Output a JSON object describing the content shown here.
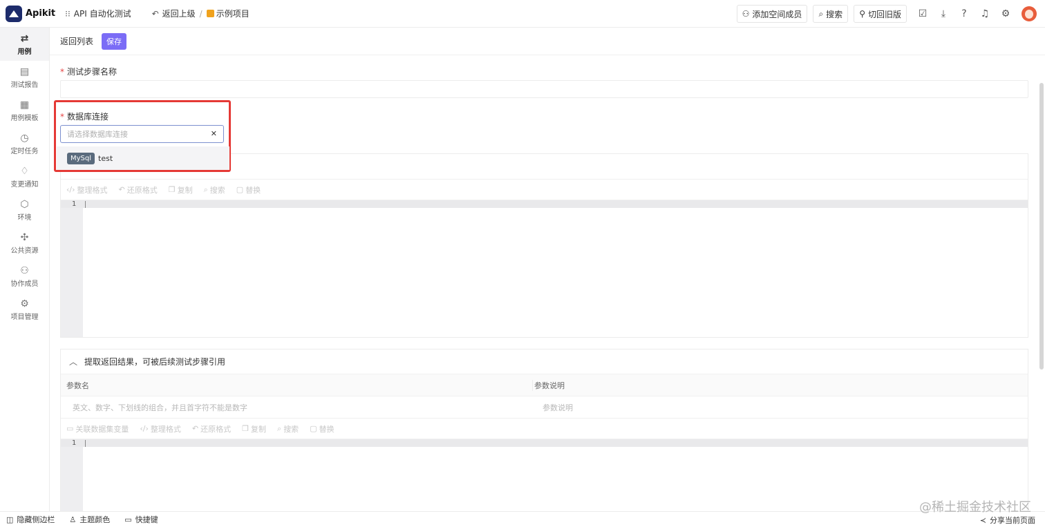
{
  "topbar": {
    "brand": "Apikit",
    "module": "API 自动化测试",
    "back_upper": "返回上级",
    "project": "示例项目",
    "add_member": "添加空间成员",
    "search": "搜索",
    "switch_old": "切回旧版"
  },
  "sidebar": {
    "items": [
      {
        "label": "用例",
        "icon": "swap-icon"
      },
      {
        "label": "测试报告",
        "icon": "report-icon"
      },
      {
        "label": "用例模板",
        "icon": "template-icon"
      },
      {
        "label": "定时任务",
        "icon": "timer-icon"
      },
      {
        "label": "变更通知",
        "icon": "bell-icon"
      },
      {
        "label": "环境",
        "icon": "cube-icon"
      },
      {
        "label": "公共资源",
        "icon": "puzzle-icon"
      },
      {
        "label": "协作成员",
        "icon": "users-icon"
      },
      {
        "label": "项目管理",
        "icon": "gear-icon"
      }
    ]
  },
  "toolbar": {
    "back_list": "返回列表",
    "save": "保存"
  },
  "form": {
    "step_name_label": "测试步骤名称",
    "db_label": "数据库连接",
    "db_placeholder": "请选择数据库连接",
    "db_option_tag": "MySql",
    "db_option_name": "test"
  },
  "editor1": {
    "tools": [
      "整理格式",
      "还原格式",
      "复制",
      "搜索",
      "替换"
    ],
    "line": "1"
  },
  "extract": {
    "title": "提取返回结果，可被后续测试步骤引用",
    "col_param": "参数名",
    "col_desc": "参数说明",
    "param_placeholder": "英文、数字、下划线的组合，并且首字符不能是数字",
    "desc_placeholder": "参数说明",
    "tools": [
      "关联数据集变量",
      "整理格式",
      "还原格式",
      "复制",
      "搜索",
      "替换"
    ],
    "line": "1"
  },
  "bottombar": {
    "hide_sidebar": "隐藏侧边栏",
    "theme_color": "主题颜色",
    "shortcuts": "快捷键",
    "share": "分享当前页面"
  },
  "watermark": "@稀土掘金技术社区",
  "colors": {
    "accent": "#7b6cf6",
    "highlight": "#e53935",
    "tag": "#5a6b7d"
  }
}
